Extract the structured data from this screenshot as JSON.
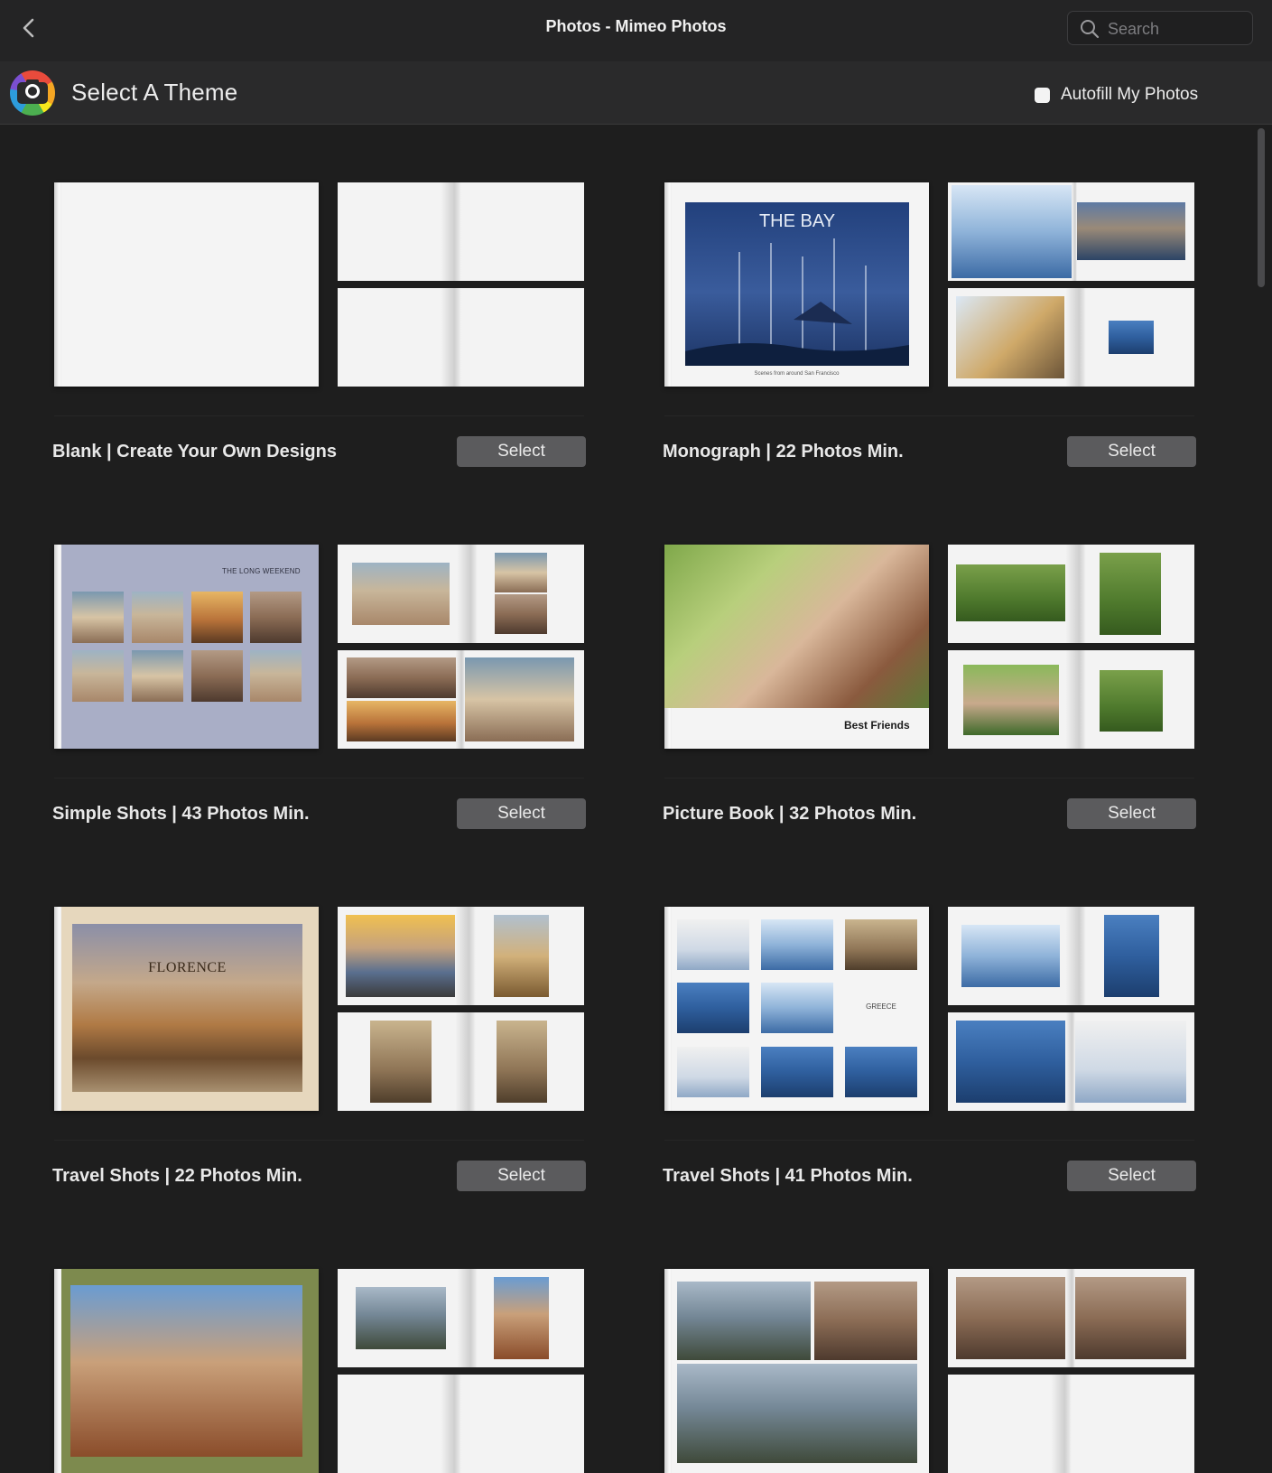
{
  "window": {
    "title": "Photos - Mimeo Photos",
    "back_label": "‹"
  },
  "search": {
    "placeholder": "Search"
  },
  "toolbar": {
    "section_title": "Select A Theme",
    "autofill_label": "Autofill My Photos"
  },
  "themes": [
    {
      "title": "Blank | Create Your Own Designs",
      "button": "Select",
      "cover_text": ""
    },
    {
      "title": "Monograph | 22 Photos Min.",
      "button": "Select",
      "cover_text": "THE BAY",
      "cover_caption": "Scenes from around San Francisco"
    },
    {
      "title": "Simple Shots | 43 Photos Min.",
      "button": "Select",
      "cover_text": "THE LONG WEEKEND"
    },
    {
      "title": "Picture Book | 32 Photos Min.",
      "button": "Select",
      "cover_text": "Best Friends"
    },
    {
      "title": "Travel Shots | 22 Photos Min.",
      "button": "Select",
      "cover_text": "FLORENCE"
    },
    {
      "title": "Travel Shots | 41 Photos Min.",
      "button": "Select",
      "cover_text": "GREECE"
    }
  ]
}
